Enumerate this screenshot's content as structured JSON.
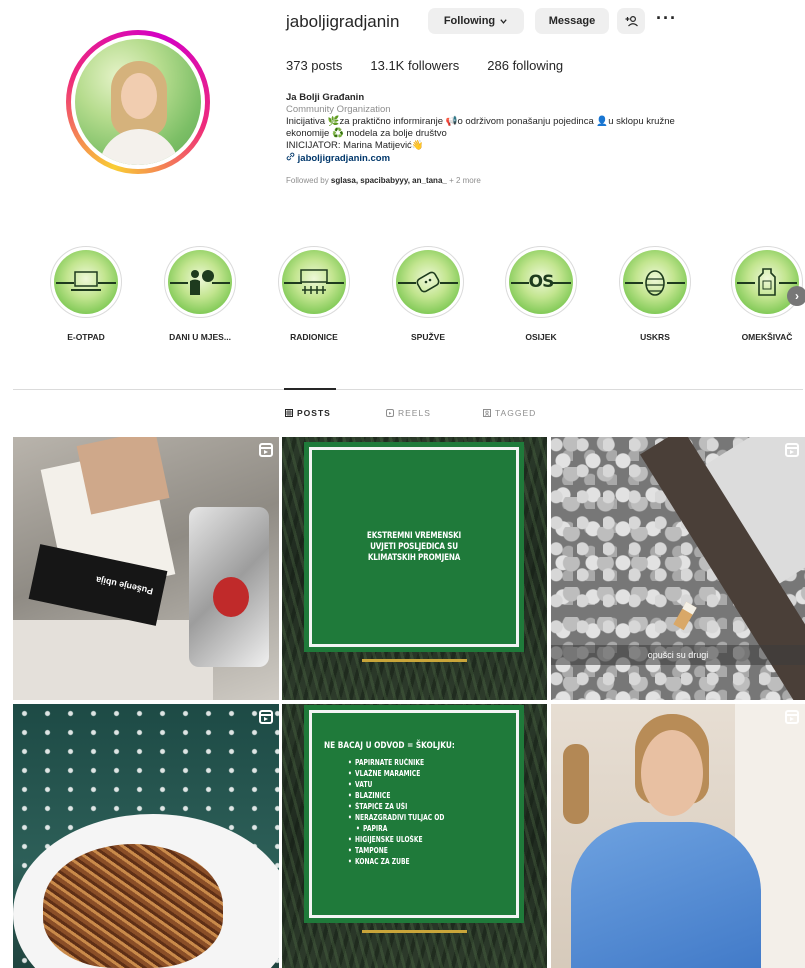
{
  "profile": {
    "username": "jaboljigradjanin",
    "following_label": "Following",
    "message_label": "Message",
    "add_user_symbol": "+",
    "more_symbol": "···",
    "stats": {
      "posts": "373 posts",
      "followers": "13.1K followers",
      "following": "286 following"
    },
    "bio": {
      "name": "Ja Bolji Građanin",
      "category": "Community Organization",
      "line1": "Inicijativa 🌿za praktično informiranje 📢o održivom ponašanju pojedinca 👤u sklopu kružne",
      "line2": "ekonomije ♻️ modela za bolje društvo",
      "line3": "INICIJATOR: Marina Matijević👋",
      "link": "jaboljigradjanin.com",
      "followed_prefix": "Followed by ",
      "followed_names": "sglasa, spacibabyyy, an_tana_",
      "followed_suffix": " + 2 more"
    }
  },
  "highlights": [
    {
      "label": "E-OTPAD",
      "icon": "laptop-icon"
    },
    {
      "label": "DANI U MJES...",
      "icon": "person-icon"
    },
    {
      "label": "RADIONICE",
      "icon": "workshop-icon"
    },
    {
      "label": "SPUŽVE",
      "icon": "sponge-icon"
    },
    {
      "label": "OSIJEK",
      "icon": "os-text",
      "text": "OS"
    },
    {
      "label": "USKRS",
      "icon": "easter-egg-icon"
    },
    {
      "label": "OMEKŠIVAČ",
      "icon": "bottle-icon"
    }
  ],
  "tabs": {
    "posts": "POSTS",
    "reels": "REELS",
    "tagged": "TAGGED"
  },
  "posts": {
    "p1": {
      "label_on_pack": "Pušenje ubija"
    },
    "p2": {
      "text": "EKSTREMNI VREMENSKI UVJETI POSLJEDICA SU KLIMATSKIH PROMJENA"
    },
    "p3": {
      "caption": "opušci su drugi"
    },
    "p5": {
      "title": "NE BACAJ U ODVOD = ŠKOLJKU:",
      "items": [
        "PAPIRNATE RUČNIKE",
        "VLAŽNE MARAMICE",
        "VATU",
        "BLAZINICE",
        "ŠTAPIĆE ZA UŠI",
        "NERAZGRADIVI TULJAC OD",
        "PAPIRA",
        "HIGIJENSKE ULOŠKE",
        "TAMPONE",
        "KONAC ZA ZUBE"
      ]
    }
  },
  "colors": {
    "ring_gradient": [
      "#f9ce34",
      "#ee2a7b",
      "#d300c5"
    ],
    "card_green": "#1f7a3a",
    "gold": "#c9a53a",
    "link": "#00376b"
  }
}
